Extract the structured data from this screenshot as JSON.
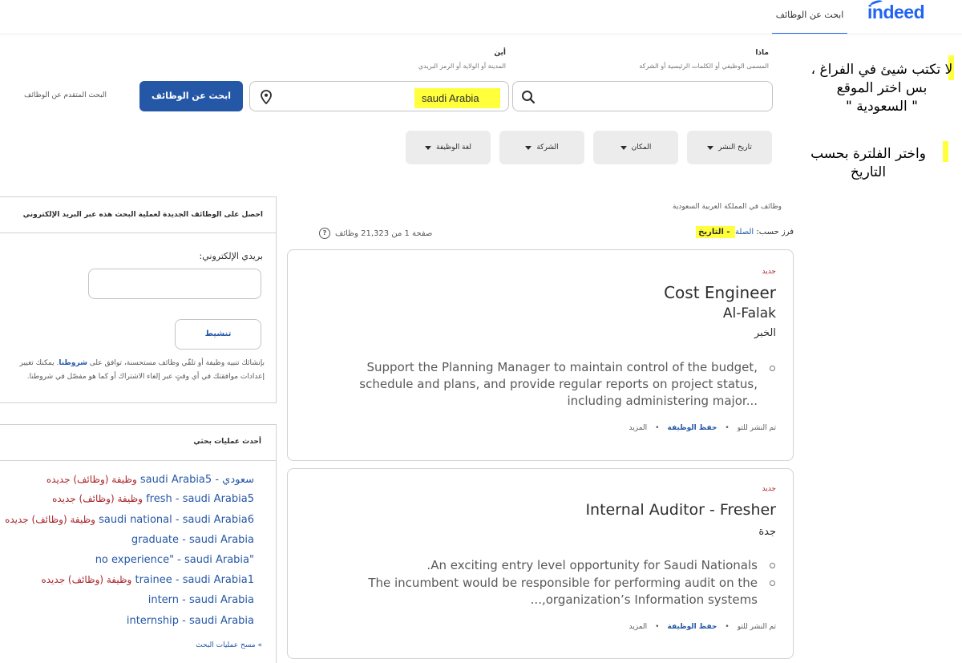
{
  "header": {
    "logo": "indeed",
    "tab_find_jobs": "ابحث عن الوظائف"
  },
  "search": {
    "what_label": "ماذا",
    "what_hint": "المسمى الوظيفي أو الكلمات الرئيسية أو الشركة",
    "what_value": "",
    "where_label": "أين",
    "where_hint": "المدينة أو الولاية أو الرمز البريدي",
    "where_value": "saudi Arabia",
    "button": "ابحث عن الوظائف",
    "advanced": "البحث المتقدم عن الوظائف"
  },
  "filters": [
    {
      "label": "تاريخ النشر"
    },
    {
      "label": "المكان"
    },
    {
      "label": "الشركة"
    },
    {
      "label": "لغة الوظيفة"
    }
  ],
  "annotations": {
    "note1_l1": "لا تكتب شيئ في الفراغ ،",
    "note1_l2": "بس اختر الموقع",
    "note1_l3": "\" السعودية \"",
    "note2_l1": "واختر الفلترة بحسب",
    "note2_l2": "التاريخ",
    "highlight_color": "#ffff3b"
  },
  "results": {
    "heading": "وظائف في المملكة العربية السعودية",
    "sort_prefix": "فرز حسب:",
    "sort_relevance": "الصلة",
    "sort_sep": " - ",
    "sort_date": "التاريخ",
    "count": "صفحة 1 من 21,323 وظائف"
  },
  "jobs": [
    {
      "badge": "جديد",
      "title": "Cost Engineer",
      "company": "Al-Falak",
      "location": "الخبر",
      "bullets": [
        "Support the Planning Manager to maintain control of the budget, schedule and plans, and provide regular reports on project status, including administering major..."
      ],
      "posted": "تم النشر للتو",
      "save": "حفظ الوظيفة",
      "more": "المزيد"
    },
    {
      "badge": "جديد",
      "title": "Internal Auditor - Fresher",
      "company": "",
      "location": "جدة",
      "bullets": [
        "An exciting entry level opportunity for Saudi Nationals.",
        "The incumbent would be responsible for performing audit on the organization’s Information systems,..."
      ],
      "posted": "تم النشر للتو",
      "save": "حفظ الوظيفة",
      "more": "المزيد"
    }
  ],
  "alert": {
    "title": "احصل على الوظائف الجديدة لعملية البحث هذه عبر البريد الإلكتروني",
    "email_label": "بريدي الإلكتروني:",
    "email_value": "",
    "button": "تنشيط",
    "fine_1": "بإنشائك تنبيه وظيفة أو تلقّي وظائف مستحسنة، توافق على ",
    "fine_link": "شروطنا",
    "fine_2": ". يمكنك تغيير إعدادات موافقتك في أي وقتٍ عبر إلغاء الاشتراك أو كما هو مفصّل في شروطنا."
  },
  "recent_searches": {
    "title": "أحدث عمليات بحثي",
    "items": [
      {
        "query": "سعودي - saudi Arabia",
        "count": "5",
        "new": "وظيفة (وظائف) جديده"
      },
      {
        "query": "fresh - saudi Arabia",
        "count": "5",
        "new": "وظيفة (وظائف) جديده"
      },
      {
        "query": "saudi national - saudi Arabia",
        "count": "6",
        "new": "وظيفة (وظائف) جديده"
      },
      {
        "query": "graduate - saudi Arabia",
        "count": "",
        "new": ""
      },
      {
        "query": "\"no experience\" - saudi Arabia",
        "count": "",
        "new": ""
      },
      {
        "query": "trainee - saudi Arabia",
        "count": "1",
        "new": "وظيفة (وظائف) جديده"
      },
      {
        "query": "intern - saudi Arabia",
        "count": "",
        "new": ""
      },
      {
        "query": "internship - saudi Arabia",
        "count": "",
        "new": ""
      }
    ],
    "clear": "» مسح عمليات البحث"
  }
}
